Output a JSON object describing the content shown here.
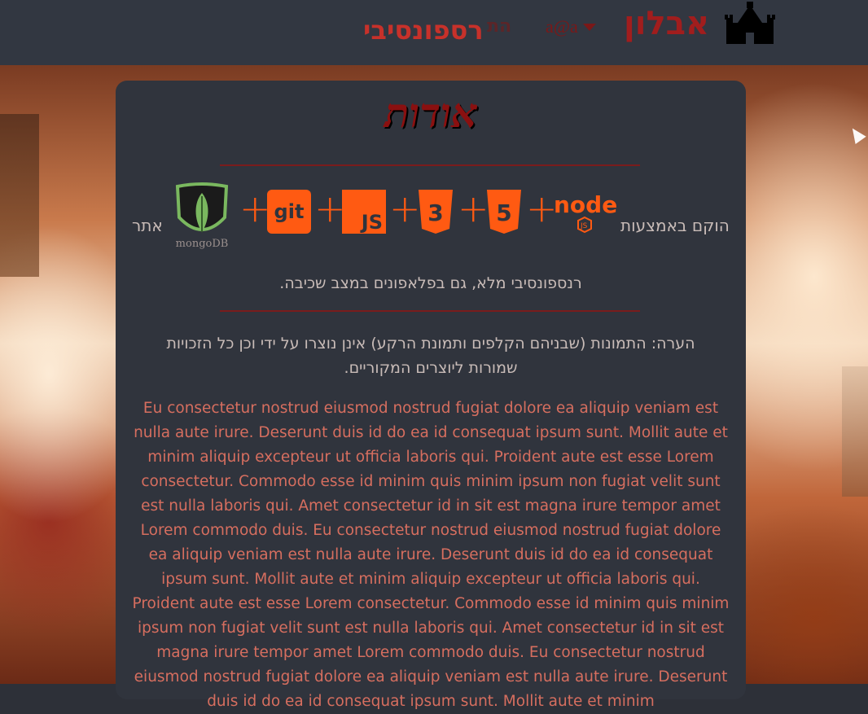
{
  "header": {
    "brand_name": "אבלון",
    "brand_icon": "castle-icon",
    "user_menu_label": "a@a",
    "faded_nav_text": "הת",
    "responsive_link": "רספונסיבי"
  },
  "card": {
    "title": "אודות",
    "built_with_label": "הוקם באמצעות",
    "site_label": "אתר",
    "tech_logos": [
      "node-logo",
      "html5-logo",
      "css3-logo",
      "js-logo",
      "git-logo",
      "mongodb-logo"
    ],
    "tech_texts": {
      "node": "node",
      "js": "JS",
      "git": "git",
      "mongo": "mongoDB"
    },
    "responsive_note": "רנספונסיבי מלא, גם בפלאפונים במצב שכיבה.",
    "credits_note": "הערה: התמונות (שבניהם הקלפים ותמונת הרקע) אינן נוצרו על ידי וכן כל הזכויות שמורות ליוצרים המקוריים.",
    "lorem": "Eu consectetur nostrud eiusmod nostrud fugiat dolore ea aliquip veniam est nulla aute irure. Deserunt duis id do ea id consequat ipsum sunt. Mollit aute et minim aliquip excepteur ut officia laboris qui. Proident aute est esse Lorem consectetur. Commodo esse id minim quis minim ipsum non fugiat velit sunt est nulla laboris qui. Amet consectetur id in sit est magna irure tempor amet Lorem commodo duis. Eu consectetur nostrud eiusmod nostrud fugiat dolore ea aliquip veniam est nulla aute irure. Deserunt duis id do ea id consequat ipsum sunt. Mollit aute et minim aliquip excepteur ut officia laboris qui. Proident aute est esse Lorem consectetur. Commodo esse id minim quis minim ipsum non fugiat velit sunt est nulla laboris qui. Amet consectetur id in sit est magna irure tempor amet Lorem commodo duis. Eu consectetur nostrud eiusmod nostrud fugiat dolore ea aliquip veniam est nulla aute irure. Deserunt duis id do ea id consequat ipsum sunt. Mollit aute et minim"
  },
  "colors": {
    "navbar": "#323741",
    "card": "#30343d",
    "accent_red": "#a11d1d",
    "tech_orange": "#ff5a12",
    "lorem_text": "#d66e5f"
  }
}
